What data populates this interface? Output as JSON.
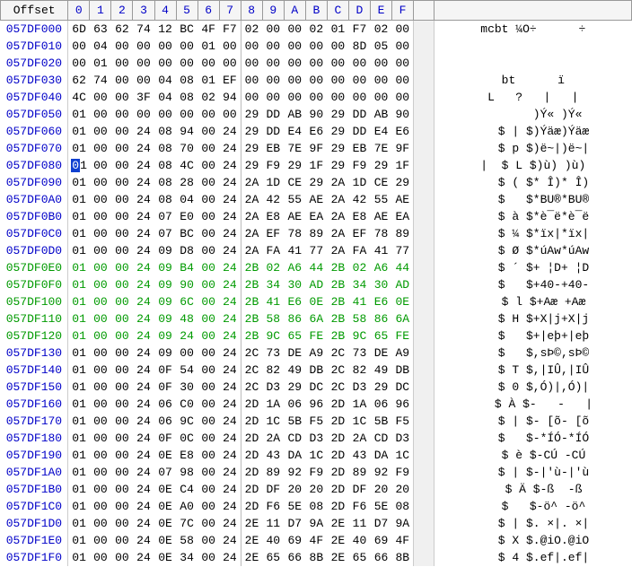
{
  "header": {
    "offset_label": "Offset",
    "cols": [
      "0",
      "1",
      "2",
      "3",
      "4",
      "5",
      "6",
      "7",
      "8",
      "9",
      "A",
      "B",
      "C",
      "D",
      "E",
      "F"
    ],
    "grip": "",
    "ascii": ""
  },
  "rows": [
    {
      "off": "057DF000",
      "hex": [
        "6D",
        "63",
        "62",
        "74",
        "12",
        "BC",
        "4F",
        "F7",
        "02",
        "00",
        "00",
        "02",
        "01",
        "F7",
        "02",
        "00"
      ],
      "asc": "mcbt ¼O÷      ÷",
      "hl": null,
      "cur": null
    },
    {
      "off": "057DF010",
      "hex": [
        "00",
        "04",
        "00",
        "00",
        "00",
        "00",
        "01",
        "00",
        "00",
        "00",
        "00",
        "00",
        "00",
        "8D",
        "05",
        "00"
      ],
      "asc": "",
      "hl": null,
      "cur": null
    },
    {
      "off": "057DF020",
      "hex": [
        "00",
        "01",
        "00",
        "00",
        "00",
        "00",
        "00",
        "00",
        "00",
        "00",
        "00",
        "00",
        "00",
        "00",
        "00",
        "00"
      ],
      "asc": "",
      "hl": null,
      "cur": null
    },
    {
      "off": "057DF030",
      "hex": [
        "62",
        "74",
        "00",
        "00",
        "04",
        "08",
        "01",
        "EF",
        "00",
        "00",
        "00",
        "00",
        "00",
        "00",
        "00",
        "00"
      ],
      "asc": "bt      ï",
      "hl": null,
      "cur": null
    },
    {
      "off": "057DF040",
      "hex": [
        "4C",
        "00",
        "00",
        "3F",
        "04",
        "08",
        "02",
        "94",
        "00",
        "00",
        "00",
        "00",
        "00",
        "00",
        "00",
        "00"
      ],
      "asc": "L   ?   |   |",
      "hl": null,
      "cur": null
    },
    {
      "off": "057DF050",
      "hex": [
        "01",
        "00",
        "00",
        "00",
        "00",
        "00",
        "00",
        "00",
        "29",
        "DD",
        "AB",
        "90",
        "29",
        "DD",
        "AB",
        "90"
      ],
      "asc": "       )Ý« )Ý«",
      "hl": null,
      "cur": null
    },
    {
      "off": "057DF060",
      "hex": [
        "01",
        "00",
        "00",
        "24",
        "08",
        "94",
        "00",
        "24",
        "29",
        "DD",
        "E4",
        "E6",
        "29",
        "DD",
        "E4",
        "E6"
      ],
      "asc": "   $ | $)Ýäæ)Ýäæ",
      "hl": null,
      "cur": null
    },
    {
      "off": "057DF070",
      "hex": [
        "01",
        "00",
        "00",
        "24",
        "08",
        "70",
        "00",
        "24",
        "29",
        "EB",
        "7E",
        "9F",
        "29",
        "EB",
        "7E",
        "9F"
      ],
      "asc": "   $ p $)ë~|)ë~|",
      "hl": null,
      "cur": null
    },
    {
      "off": "057DF080",
      "hex": [
        "01",
        "00",
        "00",
        "24",
        "08",
        "4C",
        "00",
        "24",
        "29",
        "F9",
        "29",
        "1F",
        "29",
        "F9",
        "29",
        "1F"
      ],
      "asc": "|  $ L $)ù) )ù)",
      "hl": null,
      "cur": 0
    },
    {
      "off": "057DF090",
      "hex": [
        "01",
        "00",
        "00",
        "24",
        "08",
        "28",
        "00",
        "24",
        "2A",
        "1D",
        "CE",
        "29",
        "2A",
        "1D",
        "CE",
        "29"
      ],
      "asc": "   $ ( $* Î)* Î)",
      "hl": null,
      "cur": null
    },
    {
      "off": "057DF0A0",
      "hex": [
        "01",
        "00",
        "00",
        "24",
        "08",
        "04",
        "00",
        "24",
        "2A",
        "42",
        "55",
        "AE",
        "2A",
        "42",
        "55",
        "AE"
      ],
      "asc": "   $   $*BU®*BU®",
      "hl": null,
      "cur": null
    },
    {
      "off": "057DF0B0",
      "hex": [
        "01",
        "00",
        "00",
        "24",
        "07",
        "E0",
        "00",
        "24",
        "2A",
        "E8",
        "AE",
        "EA",
        "2A",
        "E8",
        "AE",
        "EA"
      ],
      "asc": "   $ à $*è¯ë*è¯ë",
      "hl": null,
      "cur": null
    },
    {
      "off": "057DF0C0",
      "hex": [
        "01",
        "00",
        "00",
        "24",
        "07",
        "BC",
        "00",
        "24",
        "2A",
        "EF",
        "78",
        "89",
        "2A",
        "EF",
        "78",
        "89"
      ],
      "asc": "   $ ¼ $*ïx|*ïx|",
      "hl": null,
      "cur": null
    },
    {
      "off": "057DF0D0",
      "hex": [
        "01",
        "00",
        "00",
        "24",
        "09",
        "D8",
        "00",
        "24",
        "2A",
        "FA",
        "41",
        "77",
        "2A",
        "FA",
        "41",
        "77"
      ],
      "asc": "   $ Ø $*úAw*úAw",
      "hl": null,
      "cur": null
    },
    {
      "off": "057DF0E0",
      "hex": [
        "01",
        "00",
        "00",
        "24",
        "09",
        "B4",
        "00",
        "24",
        "2B",
        "02",
        "A6",
        "44",
        "2B",
        "02",
        "A6",
        "44"
      ],
      "asc": "   $ ´ $+ ¦D+ ¦D",
      "hl": "a",
      "cur": null
    },
    {
      "off": "057DF0F0",
      "hex": [
        "01",
        "00",
        "00",
        "24",
        "09",
        "90",
        "00",
        "24",
        "2B",
        "34",
        "30",
        "AD",
        "2B",
        "34",
        "30",
        "AD"
      ],
      "asc": "   $   $+40-+40-",
      "hl": "a",
      "cur": null
    },
    {
      "off": "057DF100",
      "hex": [
        "01",
        "00",
        "00",
        "24",
        "09",
        "6C",
        "00",
        "24",
        "2B",
        "41",
        "E6",
        "0E",
        "2B",
        "41",
        "E6",
        "0E"
      ],
      "asc": "   $ l $+Aæ +Aæ",
      "hl": "a",
      "cur": null
    },
    {
      "off": "057DF110",
      "hex": [
        "01",
        "00",
        "00",
        "24",
        "09",
        "48",
        "00",
        "24",
        "2B",
        "58",
        "86",
        "6A",
        "2B",
        "58",
        "86",
        "6A"
      ],
      "asc": "   $ H $+X|j+X|j",
      "hl": "a",
      "cur": null
    },
    {
      "off": "057DF120",
      "hex": [
        "01",
        "00",
        "00",
        "24",
        "09",
        "24",
        "00",
        "24",
        "2B",
        "9C",
        "65",
        "FE",
        "2B",
        "9C",
        "65",
        "FE"
      ],
      "asc": "   $   $+|eþ+|eþ",
      "hl": "b",
      "cur": null
    },
    {
      "off": "057DF130",
      "hex": [
        "01",
        "00",
        "00",
        "24",
        "09",
        "00",
        "00",
        "24",
        "2C",
        "73",
        "DE",
        "A9",
        "2C",
        "73",
        "DE",
        "A9"
      ],
      "asc": "   $   $,sÞ©,sÞ©",
      "hl": null,
      "cur": null
    },
    {
      "off": "057DF140",
      "hex": [
        "01",
        "00",
        "00",
        "24",
        "0F",
        "54",
        "00",
        "24",
        "2C",
        "82",
        "49",
        "DB",
        "2C",
        "82",
        "49",
        "DB"
      ],
      "asc": "   $ T $,|IÛ,|IÛ",
      "hl": null,
      "cur": null
    },
    {
      "off": "057DF150",
      "hex": [
        "01",
        "00",
        "00",
        "24",
        "0F",
        "30",
        "00",
        "24",
        "2C",
        "D3",
        "29",
        "DC",
        "2C",
        "D3",
        "29",
        "DC"
      ],
      "asc": "   $ 0 $,Ó)|,Ó)|",
      "hl": null,
      "cur": null
    },
    {
      "off": "057DF160",
      "hex": [
        "01",
        "00",
        "00",
        "24",
        "06",
        "C0",
        "00",
        "24",
        "2D",
        "1A",
        "06",
        "96",
        "2D",
        "1A",
        "06",
        "96"
      ],
      "asc": "   $ À $-   -   |",
      "hl": null,
      "cur": null
    },
    {
      "off": "057DF170",
      "hex": [
        "01",
        "00",
        "00",
        "24",
        "06",
        "9C",
        "00",
        "24",
        "2D",
        "1C",
        "5B",
        "F5",
        "2D",
        "1C",
        "5B",
        "F5"
      ],
      "asc": "   $ | $- [õ- [õ",
      "hl": null,
      "cur": null
    },
    {
      "off": "057DF180",
      "hex": [
        "01",
        "00",
        "00",
        "24",
        "0F",
        "0C",
        "00",
        "24",
        "2D",
        "2A",
        "CD",
        "D3",
        "2D",
        "2A",
        "CD",
        "D3"
      ],
      "asc": "   $   $-*ÍÓ-*ÍÓ",
      "hl": null,
      "cur": null
    },
    {
      "off": "057DF190",
      "hex": [
        "01",
        "00",
        "00",
        "24",
        "0E",
        "E8",
        "00",
        "24",
        "2D",
        "43",
        "DA",
        "1C",
        "2D",
        "43",
        "DA",
        "1C"
      ],
      "asc": "   $ è $-CÚ -CÚ",
      "hl": null,
      "cur": null
    },
    {
      "off": "057DF1A0",
      "hex": [
        "01",
        "00",
        "00",
        "24",
        "07",
        "98",
        "00",
        "24",
        "2D",
        "89",
        "92",
        "F9",
        "2D",
        "89",
        "92",
        "F9"
      ],
      "asc": "   $ | $-|'ù-|'ù",
      "hl": null,
      "cur": null
    },
    {
      "off": "057DF1B0",
      "hex": [
        "01",
        "00",
        "00",
        "24",
        "0E",
        "C4",
        "00",
        "24",
        "2D",
        "DF",
        "20",
        "20",
        "2D",
        "DF",
        "20",
        "20"
      ],
      "asc": "   $ Ä $-ß  -ß",
      "hl": null,
      "cur": null
    },
    {
      "off": "057DF1C0",
      "hex": [
        "01",
        "00",
        "00",
        "24",
        "0E",
        "A0",
        "00",
        "24",
        "2D",
        "F6",
        "5E",
        "08",
        "2D",
        "F6",
        "5E",
        "08"
      ],
      "asc": "   $   $-ö^ -ö^",
      "hl": null,
      "cur": null
    },
    {
      "off": "057DF1D0",
      "hex": [
        "01",
        "00",
        "00",
        "24",
        "0E",
        "7C",
        "00",
        "24",
        "2E",
        "11",
        "D7",
        "9A",
        "2E",
        "11",
        "D7",
        "9A"
      ],
      "asc": "   $ | $. ×|. ×|",
      "hl": null,
      "cur": null
    },
    {
      "off": "057DF1E0",
      "hex": [
        "01",
        "00",
        "00",
        "24",
        "0E",
        "58",
        "00",
        "24",
        "2E",
        "40",
        "69",
        "4F",
        "2E",
        "40",
        "69",
        "4F"
      ],
      "asc": "   $ X $.@iO.@iO",
      "hl": null,
      "cur": null
    },
    {
      "off": "057DF1F0",
      "hex": [
        "01",
        "00",
        "00",
        "24",
        "0E",
        "34",
        "00",
        "24",
        "2E",
        "65",
        "66",
        "8B",
        "2E",
        "65",
        "66",
        "8B"
      ],
      "asc": "   $ 4 $.ef|.ef|",
      "hl": null,
      "cur": null
    }
  ],
  "watermark": ""
}
